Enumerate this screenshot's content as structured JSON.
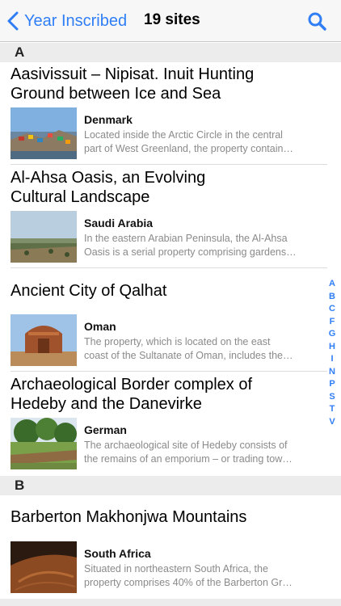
{
  "nav": {
    "back_label": "Year Inscribed",
    "title": "19 sites"
  },
  "sections": {
    "a": "A",
    "b": "B"
  },
  "items": [
    {
      "title_l1": "Aasivissuit – Nipisat. Inuit Hunting",
      "title_l2": "Ground between Ice and Sea",
      "country": "Denmark",
      "desc_l1": "Located inside the Arctic Circle in the central",
      "desc_l2": "part of West Greenland, the property contain…"
    },
    {
      "title_l1": "Al-Ahsa Oasis, an Evolving",
      "title_l2": "Cultural Landscape",
      "country": "Saudi Arabia",
      "desc_l1": "In the eastern Arabian Peninsula, the Al-Ahsa",
      "desc_l2": "Oasis is a serial property comprising gardens…"
    },
    {
      "title_l1": "Ancient City of Qalhat",
      "country": "Oman",
      "desc_l1": "The property, which is located on the east",
      "desc_l2": "coast of the Sultanate of Oman, includes the…"
    },
    {
      "title_l1": "Archaeological Border complex of",
      "title_l2": "Hedeby and the Danevirke",
      "country": "German",
      "desc_l1": "The archaeological site of Hedeby consists of",
      "desc_l2": "the remains of an emporium – or trading tow…"
    },
    {
      "title_l1": "Barberton Makhonjwa Mountains",
      "country": "South Africa",
      "desc_l1": "Situated in northeastern South Africa, the",
      "desc_l2": "property comprises 40% of the Barberton Gr…"
    }
  ],
  "index_letters": [
    "A",
    "B",
    "C",
    "F",
    "G",
    "H",
    "I",
    "N",
    "P",
    "S",
    "T",
    "V"
  ],
  "colors": {
    "accent": "#2f7ef6",
    "section_bg": "#ececec",
    "secondary_text": "#8a8a8a"
  },
  "icons": {
    "back": "chevron-left-icon",
    "search": "search-icon"
  }
}
